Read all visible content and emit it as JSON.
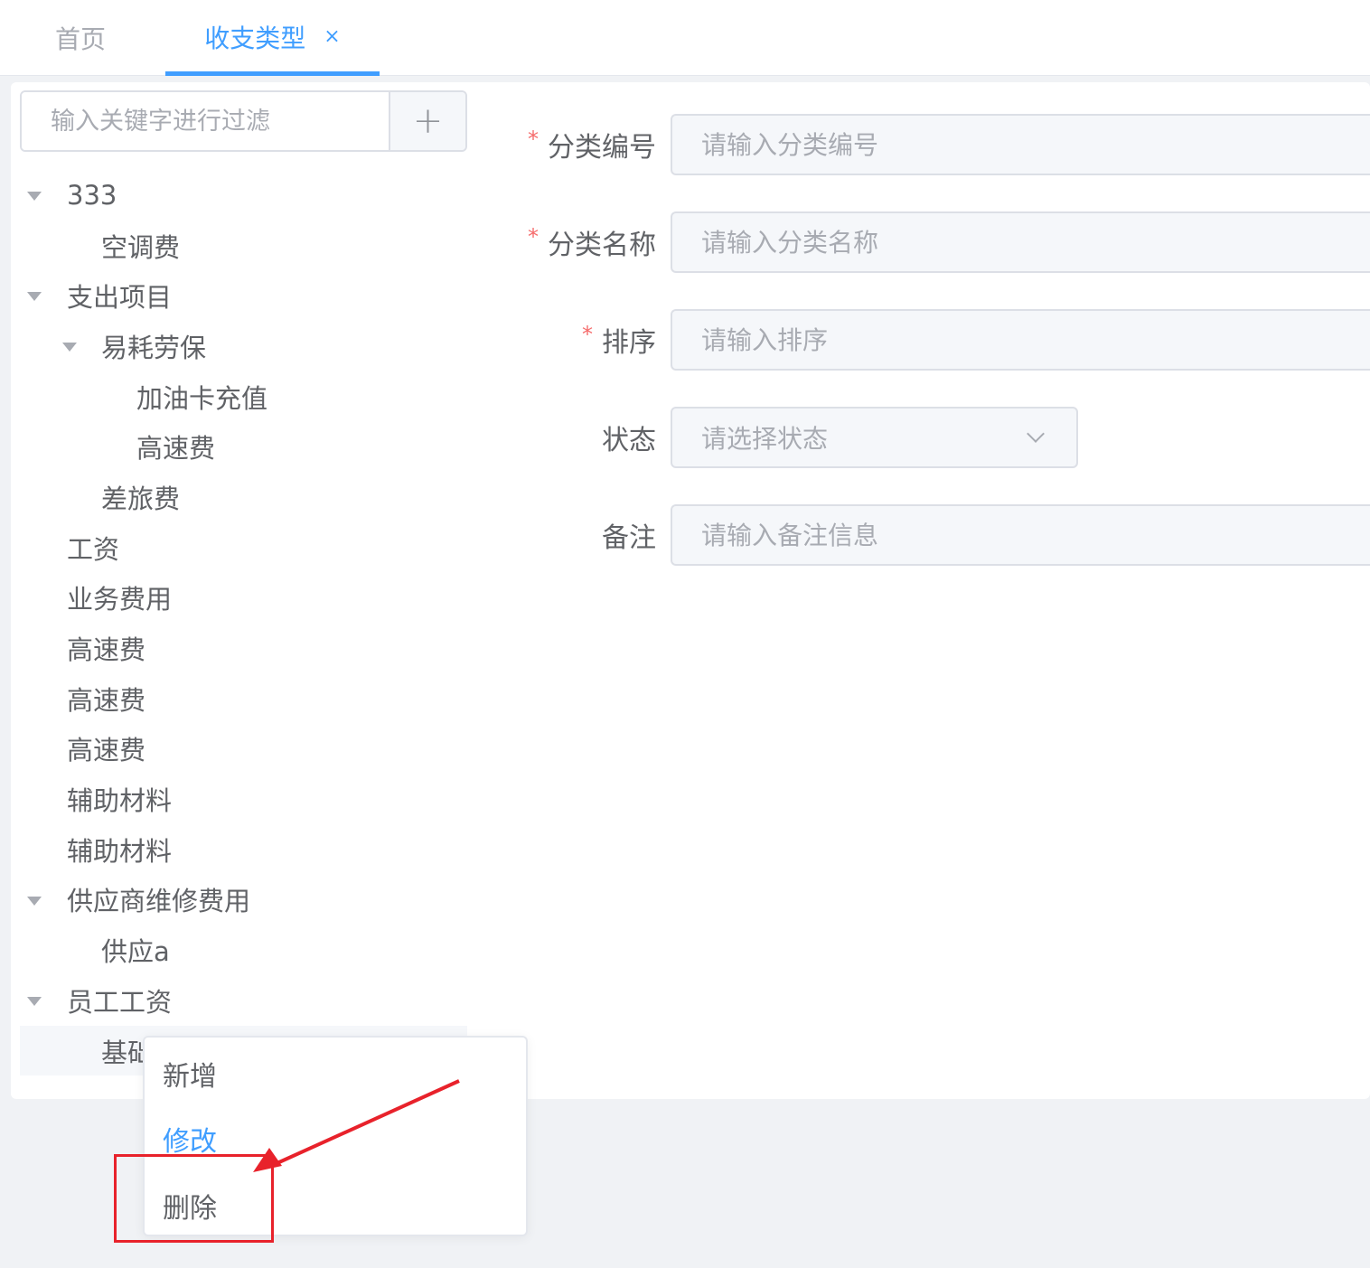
{
  "tabs": {
    "home": "首页",
    "active": "收支类型",
    "close_icon": "×"
  },
  "filter": {
    "placeholder": "输入关键字进行过滤",
    "add_icon": "+"
  },
  "tree": [
    {
      "label": "333",
      "level": 0,
      "expanded": true
    },
    {
      "label": "空调费",
      "level": 1
    },
    {
      "label": "支出项目",
      "level": 0,
      "expanded": true
    },
    {
      "label": "易耗劳保",
      "level": 1,
      "expanded": true
    },
    {
      "label": "加油卡充值",
      "level": 2
    },
    {
      "label": "高速费",
      "level": 2
    },
    {
      "label": "差旅费",
      "level": 1
    },
    {
      "label": "工资",
      "level": 0
    },
    {
      "label": "业务费用",
      "level": 0
    },
    {
      "label": "高速费",
      "level": 0
    },
    {
      "label": "高速费",
      "level": 0
    },
    {
      "label": "高速费",
      "level": 0
    },
    {
      "label": "辅助材料",
      "level": 0
    },
    {
      "label": "辅助材料",
      "level": 0
    },
    {
      "label": "供应商维修费用",
      "level": 0,
      "expanded": true
    },
    {
      "label": "供应a",
      "level": 1
    },
    {
      "label": "员工工资",
      "level": 0,
      "expanded": true
    },
    {
      "label": "基础",
      "level": 1,
      "selected": true
    }
  ],
  "form": {
    "code": {
      "label": "分类编号",
      "required": "*",
      "placeholder": "请输入分类编号"
    },
    "name": {
      "label": "分类名称",
      "required": "*",
      "placeholder": "请输入分类名称"
    },
    "sort": {
      "label": "排序",
      "required": "*",
      "placeholder": "请输入排序"
    },
    "status": {
      "label": "状态",
      "placeholder": "请选择状态"
    },
    "remark": {
      "label": "备注",
      "placeholder": "请输入备注信息"
    }
  },
  "context_menu": {
    "add": "新增",
    "edit": "修改",
    "delete": "删除"
  },
  "colors": {
    "primary": "#409eff",
    "required": "#f56c6c",
    "annotation": "#e8222b"
  }
}
